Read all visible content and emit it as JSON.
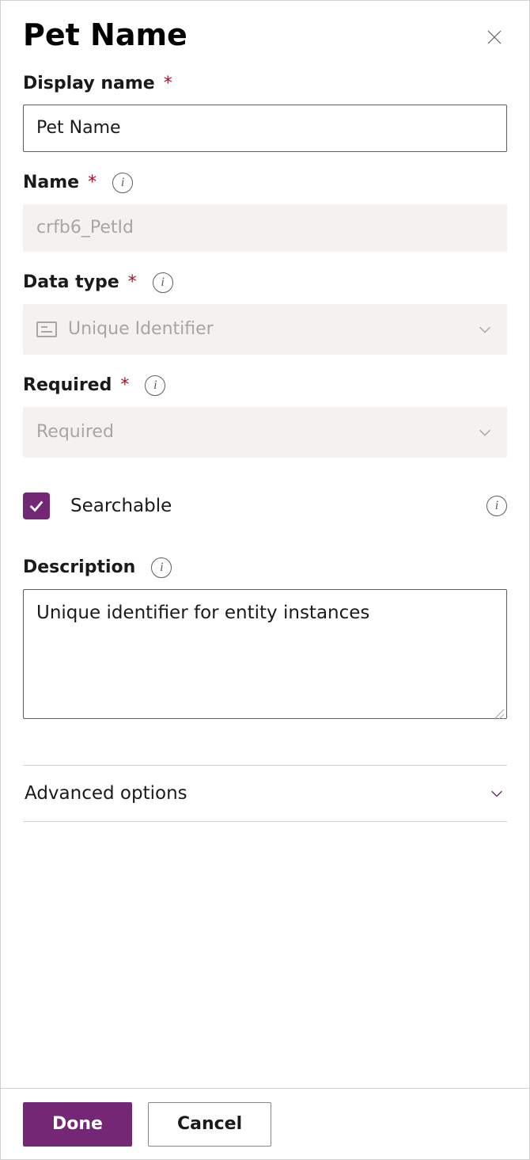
{
  "header": {
    "title": "Pet Name"
  },
  "fields": {
    "display_name": {
      "label": "Display name",
      "value": "Pet Name",
      "required": true
    },
    "name": {
      "label": "Name",
      "value": "crfb6_PetId",
      "required": true,
      "disabled": true
    },
    "data_type": {
      "label": "Data type",
      "value": "Unique Identifier",
      "required": true,
      "disabled": true
    },
    "required_field": {
      "label": "Required",
      "value": "Required",
      "required": true,
      "disabled": true
    },
    "searchable": {
      "label": "Searchable",
      "checked": true
    },
    "description": {
      "label": "Description",
      "value": "Unique identifier for entity instances"
    }
  },
  "advanced": {
    "label": "Advanced options"
  },
  "footer": {
    "done": "Done",
    "cancel": "Cancel"
  },
  "colors": {
    "accent": "#742774"
  }
}
